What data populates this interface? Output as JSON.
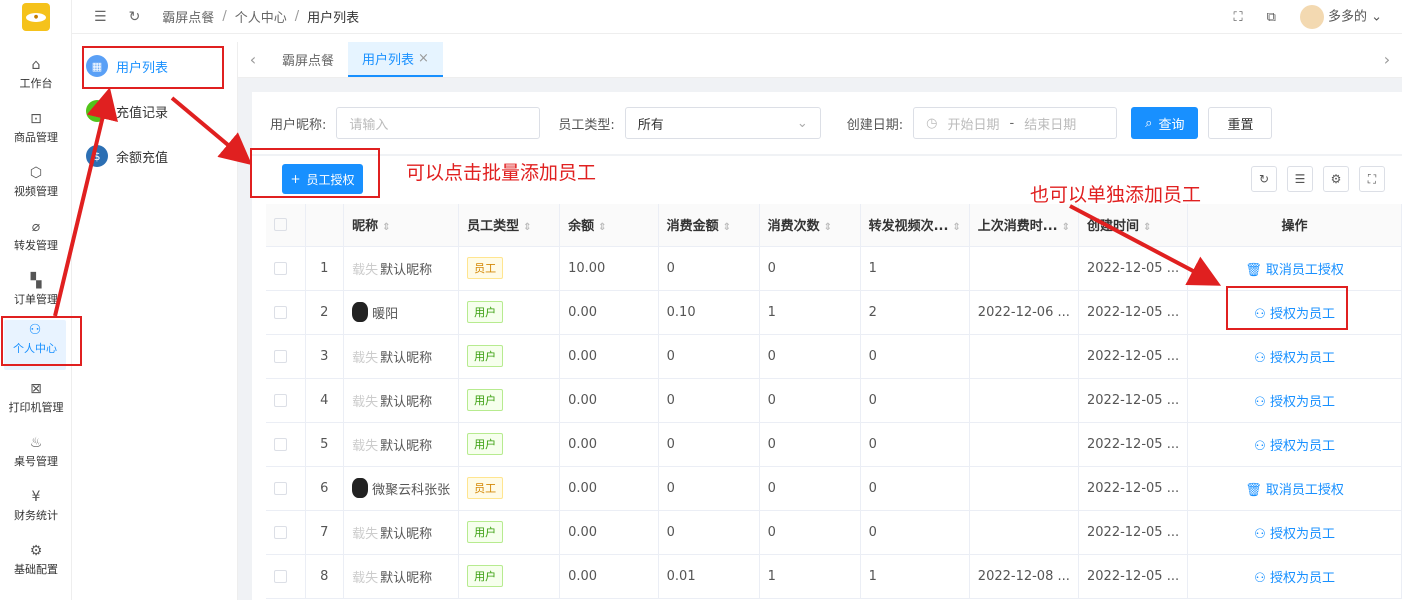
{
  "sidebar": {
    "items": [
      {
        "label": "工作台",
        "icon": "home-icon"
      },
      {
        "label": "商品管理",
        "icon": "goods-icon"
      },
      {
        "label": "视频管理",
        "icon": "video-icon"
      },
      {
        "label": "转发管理",
        "icon": "paperclip-icon"
      },
      {
        "label": "订单管理",
        "icon": "cart-icon"
      },
      {
        "label": "个人中心",
        "icon": "user-icon"
      },
      {
        "label": "打印机管理",
        "icon": "printer-icon"
      },
      {
        "label": "桌号管理",
        "icon": "table-icon"
      },
      {
        "label": "财务统计",
        "icon": "yen-icon"
      },
      {
        "label": "基础配置",
        "icon": "gears-icon"
      }
    ]
  },
  "submenu": {
    "items": [
      {
        "label": "用户列表",
        "color": "#5aa0f6"
      },
      {
        "label": "充值记录",
        "color": "#52c41a"
      },
      {
        "label": "余额充值",
        "color": "#2c6fb3"
      }
    ]
  },
  "breadcrumb": {
    "items": [
      "霸屏点餐",
      "个人中心",
      "用户列表"
    ]
  },
  "user": {
    "name": "多多的"
  },
  "tabs": {
    "items": [
      "霸屏点餐",
      "用户列表"
    ]
  },
  "filter": {
    "nickname_label": "用户昵称:",
    "nickname_placeholder": "请输入",
    "type_label": "员工类型:",
    "type_value": "所有",
    "date_label": "创建日期:",
    "start_placeholder": "开始日期",
    "date_sep": "-",
    "end_placeholder": "结束日期",
    "query_label": "查询",
    "reset_label": "重置"
  },
  "toolbar": {
    "auth_label": "员工授权"
  },
  "table": {
    "headers": [
      "昵称",
      "员工类型",
      "余额",
      "消费金额",
      "消费次数",
      "转发视频次...",
      "上次消费时...",
      "创建时间",
      "操作"
    ],
    "rows": [
      {
        "idx": "1",
        "blur": "载失",
        "name": "默认昵称",
        "pic": false,
        "type": "员工",
        "emp": true,
        "balance": "10.00",
        "amount": "0",
        "count": "0",
        "fwd": "1",
        "last": "",
        "created": "2022-12-05 ...",
        "op": "取消员工授权",
        "op_icon": "trash-icon"
      },
      {
        "idx": "2",
        "blur": "",
        "name": "暖阳",
        "pic": true,
        "type": "用户",
        "emp": false,
        "balance": "0.00",
        "amount": "0.10",
        "count": "1",
        "fwd": "2",
        "last": "2022-12-06 ...",
        "created": "2022-12-05 ...",
        "op": "授权为员工",
        "op_icon": "user-icon"
      },
      {
        "idx": "3",
        "blur": "载失",
        "name": "默认昵称",
        "pic": false,
        "type": "用户",
        "emp": false,
        "balance": "0.00",
        "amount": "0",
        "count": "0",
        "fwd": "0",
        "last": "",
        "created": "2022-12-05 ...",
        "op": "授权为员工",
        "op_icon": "user-icon"
      },
      {
        "idx": "4",
        "blur": "载失",
        "name": "默认昵称",
        "pic": false,
        "type": "用户",
        "emp": false,
        "balance": "0.00",
        "amount": "0",
        "count": "0",
        "fwd": "0",
        "last": "",
        "created": "2022-12-05 ...",
        "op": "授权为员工",
        "op_icon": "user-icon"
      },
      {
        "idx": "5",
        "blur": "载失",
        "name": "默认昵称",
        "pic": false,
        "type": "用户",
        "emp": false,
        "balance": "0.00",
        "amount": "0",
        "count": "0",
        "fwd": "0",
        "last": "",
        "created": "2022-12-05 ...",
        "op": "授权为员工",
        "op_icon": "user-icon"
      },
      {
        "idx": "6",
        "blur": "",
        "name": "微聚云科张张",
        "pic": true,
        "type": "员工",
        "emp": true,
        "balance": "0.00",
        "amount": "0",
        "count": "0",
        "fwd": "0",
        "last": "",
        "created": "2022-12-05 ...",
        "op": "取消员工授权",
        "op_icon": "trash-icon"
      },
      {
        "idx": "7",
        "blur": "载失",
        "name": "默认昵称",
        "pic": false,
        "type": "用户",
        "emp": false,
        "balance": "0.00",
        "amount": "0",
        "count": "0",
        "fwd": "0",
        "last": "",
        "created": "2022-12-05 ...",
        "op": "授权为员工",
        "op_icon": "user-icon"
      },
      {
        "idx": "8",
        "blur": "载失",
        "name": "默认昵称",
        "pic": false,
        "type": "用户",
        "emp": false,
        "balance": "0.00",
        "amount": "0.01",
        "count": "1",
        "fwd": "1",
        "last": "2022-12-08 ...",
        "created": "2022-12-05 ...",
        "op": "授权为员工",
        "op_icon": "user-icon"
      }
    ]
  },
  "annotations": {
    "batch": "可以点击批量添加员工",
    "single": "也可以单独添加员工",
    "color": "#e02020"
  }
}
